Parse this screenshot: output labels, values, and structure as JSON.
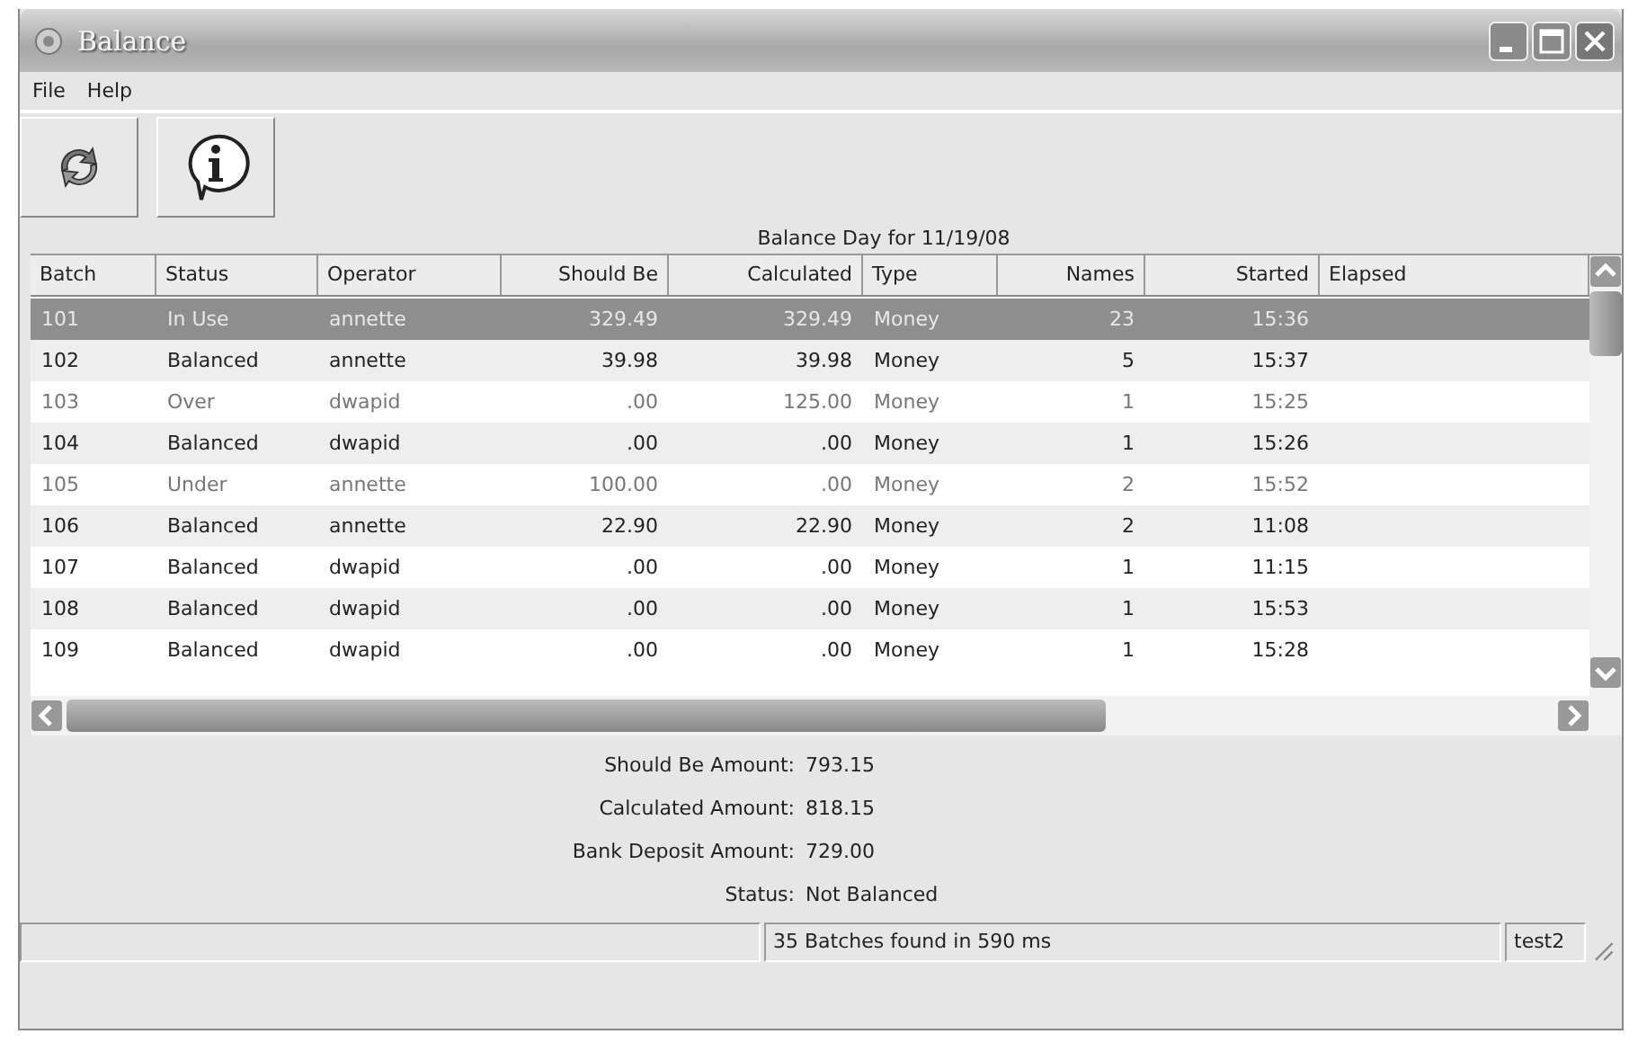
{
  "window": {
    "title": "Balance"
  },
  "menu": [
    "File",
    "Help"
  ],
  "caption": "Balance Day for 11/19/08",
  "table": {
    "columns": [
      "Batch",
      "Status",
      "Operator",
      "Should Be",
      "Calculated",
      "Type",
      "Names",
      "Started",
      "Elapsed"
    ],
    "rows": [
      {
        "cells": [
          "101",
          "In Use",
          "annette",
          "329.49",
          "329.49",
          "Money",
          "23",
          "15:36"
        ],
        "selected": true,
        "dimmed": false
      },
      {
        "cells": [
          "102",
          "Balanced",
          "annette",
          "39.98",
          "39.98",
          "Money",
          "5",
          "15:37"
        ],
        "selected": false,
        "dimmed": false
      },
      {
        "cells": [
          "103",
          "Over",
          "dwapid",
          ".00",
          "125.00",
          "Money",
          "1",
          "15:25"
        ],
        "selected": false,
        "dimmed": true
      },
      {
        "cells": [
          "104",
          "Balanced",
          "dwapid",
          ".00",
          ".00",
          "Money",
          "1",
          "15:26"
        ],
        "selected": false,
        "dimmed": false
      },
      {
        "cells": [
          "105",
          "Under",
          "annette",
          "100.00",
          ".00",
          "Money",
          "2",
          "15:52"
        ],
        "selected": false,
        "dimmed": true
      },
      {
        "cells": [
          "106",
          "Balanced",
          "annette",
          "22.90",
          "22.90",
          "Money",
          "2",
          "11:08"
        ],
        "selected": false,
        "dimmed": false
      },
      {
        "cells": [
          "107",
          "Balanced",
          "dwapid",
          ".00",
          ".00",
          "Money",
          "1",
          "11:15"
        ],
        "selected": false,
        "dimmed": false
      },
      {
        "cells": [
          "108",
          "Balanced",
          "dwapid",
          ".00",
          ".00",
          "Money",
          "1",
          "15:53"
        ],
        "selected": false,
        "dimmed": false
      },
      {
        "cells": [
          "109",
          "Balanced",
          "dwapid",
          ".00",
          ".00",
          "Money",
          "1",
          "15:28"
        ],
        "selected": false,
        "dimmed": false
      }
    ]
  },
  "summary": [
    {
      "label": "Should Be Amount:",
      "value": "793.15"
    },
    {
      "label": "Calculated Amount:",
      "value": "818.15"
    },
    {
      "label": "Bank Deposit Amount:",
      "value": "729.00"
    },
    {
      "label": "Status:",
      "value": "Not Balanced"
    }
  ],
  "status_bar": {
    "message": "35 Batches found in 590 ms",
    "user": "test2"
  }
}
